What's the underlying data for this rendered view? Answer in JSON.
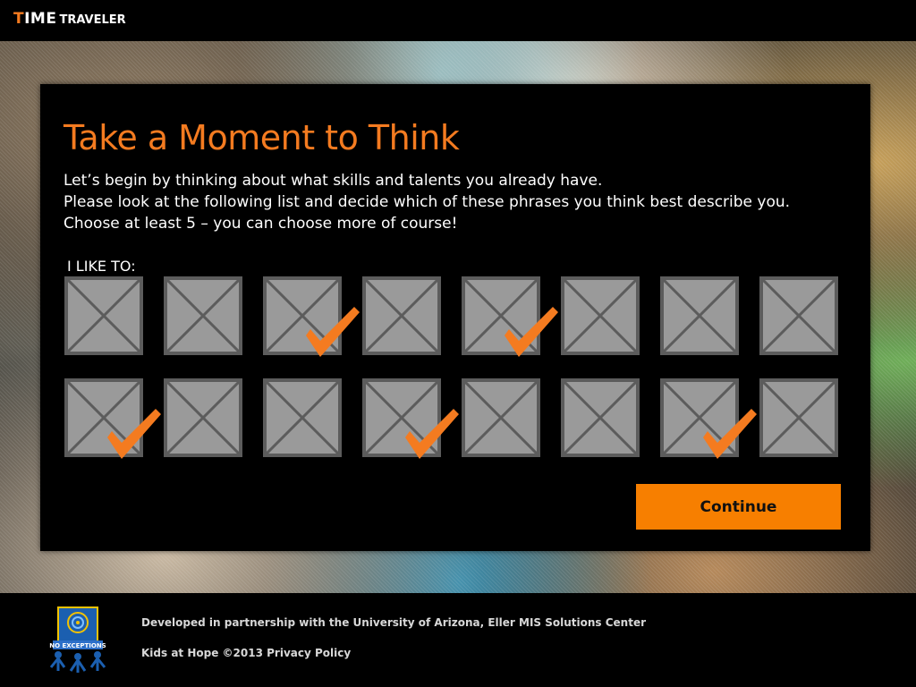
{
  "app": {
    "brand_time": "TIME",
    "brand_traveler": "TRAVELER"
  },
  "page": {
    "title": "Take a Moment to Think",
    "intro": [
      "Let’s begin by thinking about what skills and talents you already have.",
      "Please look at the following list and decide which of these phrases you think best describe you.",
      "Choose at least 5 – you can choose more of course!"
    ],
    "list_label": "I LIKE TO:",
    "continue_label": "Continue"
  },
  "options": [
    {
      "checked": false
    },
    {
      "checked": false
    },
    {
      "checked": true
    },
    {
      "checked": false
    },
    {
      "checked": true
    },
    {
      "checked": false
    },
    {
      "checked": false
    },
    {
      "checked": false
    },
    {
      "checked": true
    },
    {
      "checked": false
    },
    {
      "checked": false
    },
    {
      "checked": true
    },
    {
      "checked": false
    },
    {
      "checked": false
    },
    {
      "checked": true
    },
    {
      "checked": false
    }
  ],
  "footer": {
    "developed": "Developed in partnership with the University of Arizona, Eller MIS Solutions Center",
    "copyright": "Kids at Hope ©2013",
    "privacy_label": "Privacy Policy",
    "logo_text": "NO EXCEPTIONS"
  },
  "colors": {
    "accent": "#f47b20",
    "button": "#f77f00",
    "tile": "#9a9a9a",
    "tile_border": "#5c5c5c"
  }
}
